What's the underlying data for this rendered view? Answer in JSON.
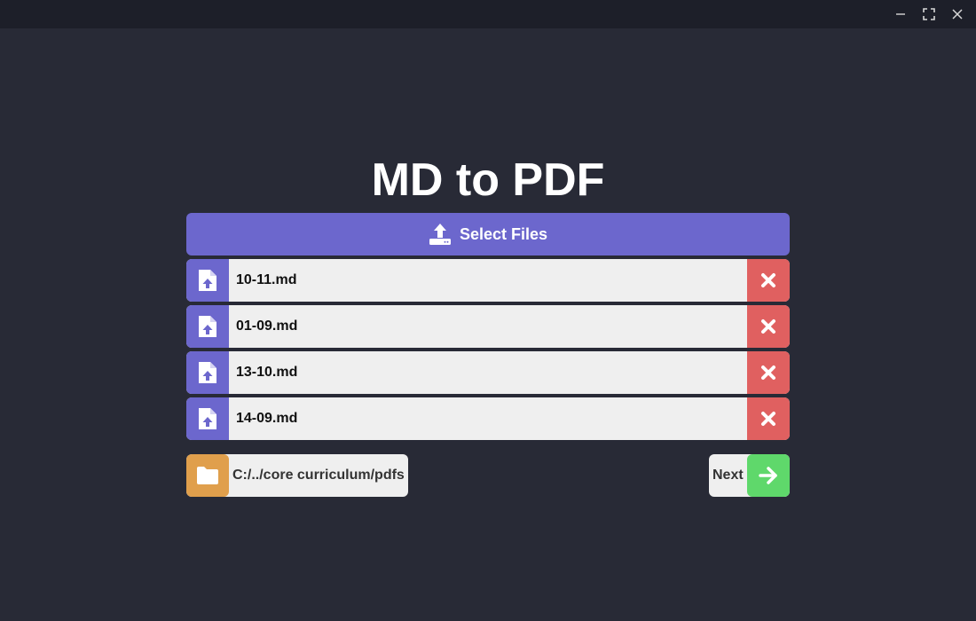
{
  "window": {
    "controls": {
      "minimize_icon": "minimize-icon",
      "maximize_icon": "maximize-icon",
      "close_icon": "close-icon"
    }
  },
  "app": {
    "title": "MD to PDF"
  },
  "select_files": {
    "label": "Select Files",
    "icon": "upload-icon"
  },
  "files": [
    {
      "name": "10-11.md",
      "icon": "file-upload-icon",
      "remove_icon": "close-icon"
    },
    {
      "name": "01-09.md",
      "icon": "file-upload-icon",
      "remove_icon": "close-icon"
    },
    {
      "name": "13-10.md",
      "icon": "file-upload-icon",
      "remove_icon": "close-icon"
    },
    {
      "name": "14-09.md",
      "icon": "file-upload-icon",
      "remove_icon": "close-icon"
    }
  ],
  "output_folder": {
    "path": "C:/../core curriculum/pdfs",
    "icon": "folder-icon"
  },
  "next": {
    "label": "Next",
    "icon": "arrow-right-icon"
  },
  "colors": {
    "background": "#282a36",
    "titlebar": "#1d1f29",
    "accent_purple": "#6c67cd",
    "remove_red": "#e06060",
    "folder_orange": "#e09f4c",
    "next_green": "#5fd86b",
    "row_bg": "#efefef"
  }
}
